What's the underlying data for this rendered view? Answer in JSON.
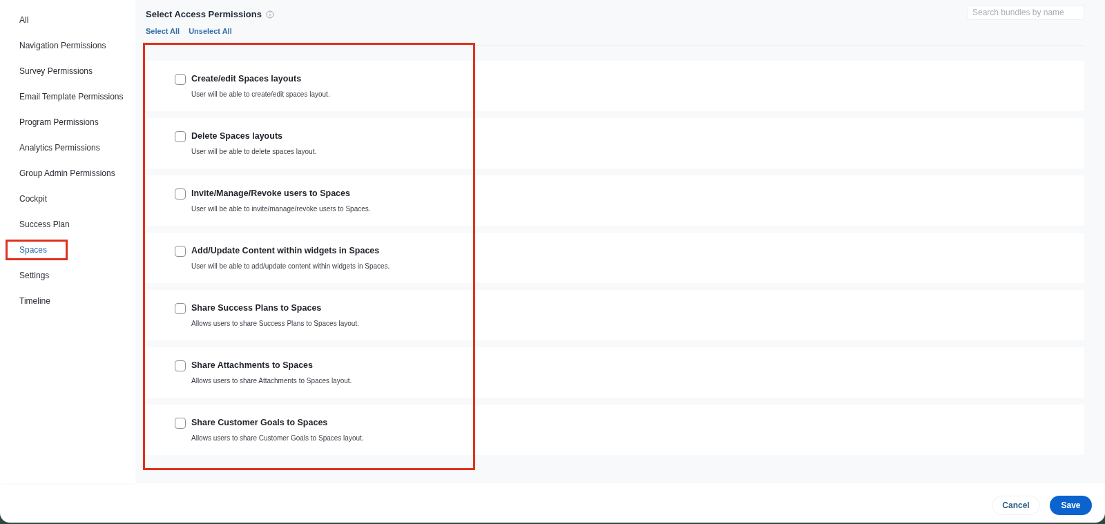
{
  "sidebar": {
    "items": [
      {
        "label": "All",
        "selected": false,
        "highlighted": false
      },
      {
        "label": "Navigation Permissions",
        "selected": false,
        "highlighted": false
      },
      {
        "label": "Survey Permissions",
        "selected": false,
        "highlighted": false
      },
      {
        "label": "Email Template Permissions",
        "selected": false,
        "highlighted": false
      },
      {
        "label": "Program Permissions",
        "selected": false,
        "highlighted": false
      },
      {
        "label": "Analytics Permissions",
        "selected": false,
        "highlighted": false
      },
      {
        "label": "Group Admin Permissions",
        "selected": false,
        "highlighted": false
      },
      {
        "label": "Cockpit",
        "selected": false,
        "highlighted": false
      },
      {
        "label": "Success Plan",
        "selected": false,
        "highlighted": false
      },
      {
        "label": "Spaces",
        "selected": true,
        "highlighted": true
      },
      {
        "label": "Settings",
        "selected": false,
        "highlighted": false
      },
      {
        "label": "Timeline",
        "selected": false,
        "highlighted": false
      }
    ]
  },
  "header": {
    "title": "Select Access Permissions",
    "select_all": "Select All",
    "unselect_all": "Unselect All"
  },
  "search": {
    "placeholder": "Search bundles by name"
  },
  "permissions_highlighted": true,
  "permissions": [
    {
      "title": "Create/edit Spaces layouts",
      "description": "User will be able to create/edit spaces layout.",
      "checked": false
    },
    {
      "title": "Delete Spaces layouts",
      "description": "User will be able to delete spaces layout.",
      "checked": false
    },
    {
      "title": "Invite/Manage/Revoke users to Spaces",
      "description": "User will be able to invite/manage/revoke users to Spaces.",
      "checked": false
    },
    {
      "title": "Add/Update Content within widgets in Spaces",
      "description": "User will be able to add/update content within widgets in Spaces.",
      "checked": false
    },
    {
      "title": "Share Success Plans to Spaces",
      "description": "Allows users to share Success Plans to Spaces layout.",
      "checked": false
    },
    {
      "title": "Share Attachments to Spaces",
      "description": "Allows users to share Attachments to Spaces layout.",
      "checked": false
    },
    {
      "title": "Share Customer Goals to Spaces",
      "description": "Allows users to share Customer Goals to Spaces layout.",
      "checked": false
    }
  ],
  "buttons": {
    "cancel": "Cancel",
    "save": "Save"
  }
}
